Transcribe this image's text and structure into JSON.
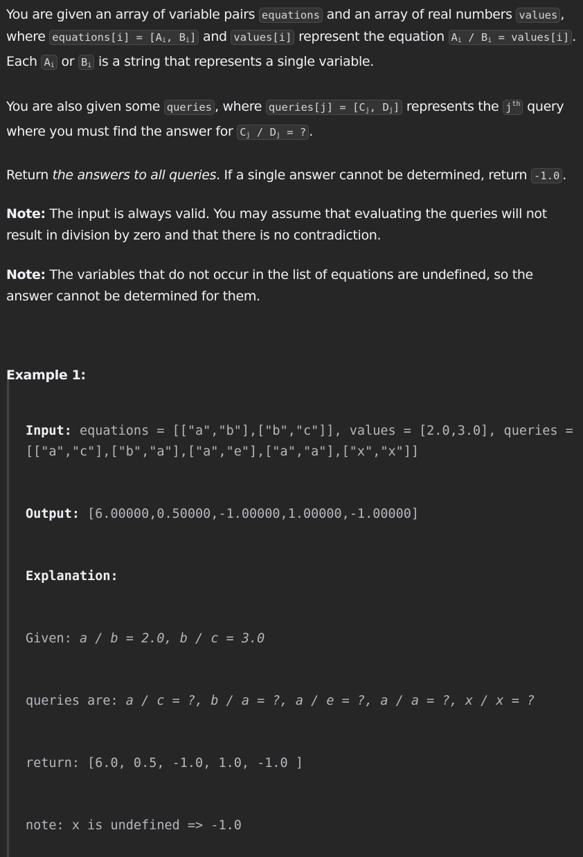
{
  "problem": {
    "p1": {
      "t1": "You are given an array of variable pairs ",
      "c1": "equations",
      "t2": " and an array of real numbers ",
      "c2": "values",
      "t3": ", where ",
      "c3": "equations[i] = [A",
      "c3_sub1": "i",
      "c3_mid": ", B",
      "c3_sub2": "i",
      "c3_end": "]",
      "t4": " and ",
      "c4": "values[i]",
      "t5": " represent the equation ",
      "c5": "A",
      "c5_sub1": "i",
      "c5_mid": " / B",
      "c5_sub2": "i",
      "c5_end": " = values[i]",
      "t6": ". Each ",
      "c6": "A",
      "c6_sub": "i",
      "t7": " or ",
      "c7": "B",
      "c7_sub": "i",
      "t8": " is a string that represents a single variable."
    },
    "p2": {
      "t1": "You are also given some ",
      "c1": "queries",
      "t2": ", where ",
      "c2": "queries[j] = [C",
      "c2_sub1": "j",
      "c2_mid": ", D",
      "c2_sub2": "j",
      "c2_end": "]",
      "t3": " represents the ",
      "c3": "j",
      "c3_sup": "th",
      "t4": " query where you must find the answer for ",
      "c4": "C",
      "c4_sub1": "j",
      "c4_mid": " / D",
      "c4_sub2": "j",
      "c4_end": " = ?",
      "t5": "."
    },
    "p3": {
      "t1": "Return ",
      "em": "the answers to all queries",
      "t2": ". If a single answer cannot be determined, return ",
      "c1": "-1.0",
      "t3": "."
    },
    "p4": {
      "label": "Note:",
      "text": " The input is always valid. You may assume that evaluating the queries will not result in division by zero and that there is no contradiction."
    },
    "p5": {
      "label": "Note:",
      "text": " The variables that do not occur in the list of equations are undefined, so the answer cannot be determined for them."
    }
  },
  "example": {
    "title": "Example 1:",
    "input_label": "Input:",
    "input_text": " equations = [[\"a\",\"b\"],[\"b\",\"c\"]], values = [2.0,3.0], queries = [[\"a\",\"c\"],[\"b\",\"a\"],[\"a\",\"e\"],[\"a\",\"a\"],[\"x\",\"x\"]]",
    "output_label": "Output:",
    "output_text": " [6.00000,0.50000,-1.00000,1.00000,-1.00000]",
    "explanation_label": "Explanation:",
    "given_label": "Given: ",
    "given_text": "a / b = 2.0, b / c = 3.0",
    "queries_label": "queries are: ",
    "queries_text": "a / c = ?, b / a = ?, a / e = ?, a / a = ?, x / x = ?",
    "return_text": "return: [6.0, 0.5, -1.0, 1.0, -1.0 ]",
    "note_text": "note: x is undefined => -1.0"
  }
}
